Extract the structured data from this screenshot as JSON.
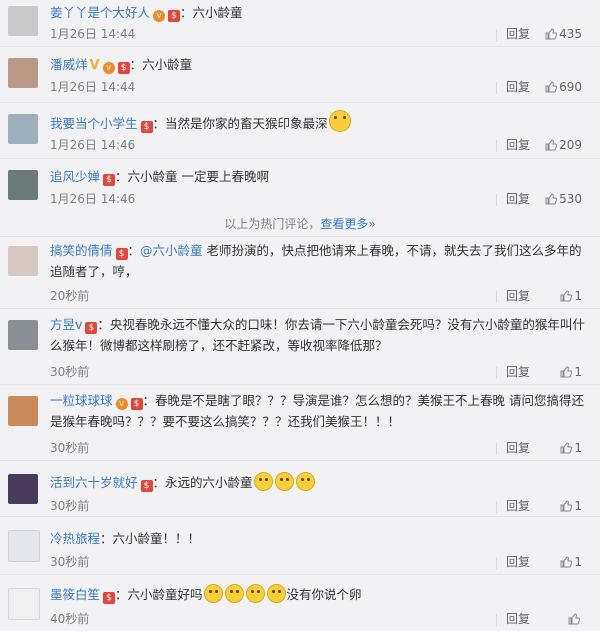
{
  "comments": [
    {
      "username": "姜丫丫是个大好人",
      "text": "：六小龄童",
      "time": "1月26日 14:44",
      "reply": "回复",
      "likes": "435",
      "bg": "#c9c9c9"
    },
    {
      "username": "潘威烊",
      "text": "：六小龄童",
      "time": "1月26日 14:44",
      "reply": "回复",
      "likes": "690",
      "bg": "#b89a86"
    },
    {
      "username": "我要当个小学生",
      "text": "：当然是你家的畜天猴印象最深",
      "time": "1月26日 14:46",
      "reply": "回复",
      "likes": "209",
      "bg": "#9fb0bc"
    },
    {
      "username": "追风少婵",
      "text": "：六小龄童  一定要上春晚啊",
      "time": "1月26日 14:46",
      "reply": "回复",
      "likes": "530",
      "bg": "#6b7b7a"
    },
    {
      "username": "搞笑的倩倩",
      "mention": "@六小龄童",
      "text": " 老师扮演的，快点把他请来上春晚，不请，就失去了我们这么多年的追随者了，哼，",
      "time": "20秒前",
      "reply": "回复",
      "likes": "1",
      "bg": "#d6c8c0"
    },
    {
      "username": "方昱v",
      "text": "：央视春晚永远不懂大众的口味！你去请一下六小龄童会死吗？没有六小龄童的猴年叫什么猴年！微博都这样刷榜了，还不赶紧改，等收视率降低那？",
      "time": "30秒前",
      "reply": "回复",
      "likes": "1",
      "bg": "#8a8f96"
    },
    {
      "username": "一粒球球球",
      "text": "：春晚是不是瞎了眼？？？导演是谁？怎么想的？美猴王不上春晚 请问您搞得还是猴年春晚吗？？？要不要这么搞笑？？？还我们美猴王！！！",
      "time": "30秒前",
      "reply": "回复",
      "likes": "1",
      "bg": "#c98a5c"
    },
    {
      "username": "活到六十岁就好",
      "text": "：永远的六小龄童",
      "time": "30秒前",
      "reply": "回复",
      "likes": "1",
      "bg": "#4a3b5a"
    },
    {
      "username": "冷热旅程",
      "text": "：六小龄童！！！",
      "time": "30秒前",
      "reply": "回复",
      "likes": "1",
      "bg": "#e3e6ea"
    },
    {
      "username": "墨筱白笙",
      "text": "：六小龄童好吗",
      "text2": "没有你说个卵",
      "time": "40秒前",
      "reply": "回复",
      "likes": "",
      "bg": "#f0f0f0"
    }
  ],
  "hot_divider": {
    "text": "以上为热门评论，",
    "more": "查看更多»"
  },
  "icons": {
    "badge": "red-envelope-badge",
    "vip": "vip-icon",
    "like": "thumbs-up-icon",
    "emoji": "smile-emoji-icon"
  },
  "colors": {
    "background": "#f2f2f5",
    "username": "#eb7350",
    "link": "#3a7bbf",
    "badge": "#e0483f"
  }
}
